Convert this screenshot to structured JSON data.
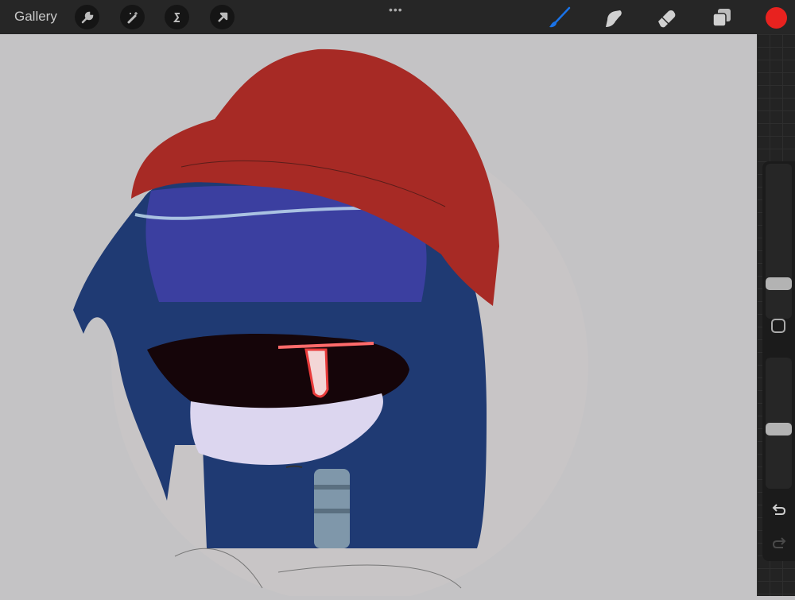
{
  "toolbar": {
    "gallery_label": "Gallery",
    "left_tools": [
      "wrench-icon",
      "magic-wand-icon",
      "selection-s-icon",
      "transform-arrow-icon"
    ],
    "more_label": "•••",
    "right_tools": [
      "brush-icon",
      "smudge-icon",
      "eraser-icon",
      "layers-icon",
      "color-swatch"
    ],
    "active_tool": "brush",
    "active_color": "#e8221f",
    "brush_active_color": "#1a73e8"
  },
  "sidebar": {
    "brush_size_fraction": 0.2,
    "opacity_fraction": 0.45,
    "modify_button": "square-icon",
    "undo": "undo-icon",
    "redo": "redo-icon"
  },
  "canvas": {
    "background": "#c4c3c5"
  }
}
